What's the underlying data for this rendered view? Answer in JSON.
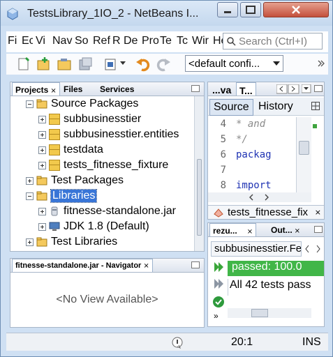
{
  "window": {
    "title": "TestsLibrary_1IO_2 - NetBeans I...",
    "minimize_label": "—",
    "maximize_label": "□",
    "close_label": "✕"
  },
  "menubar": {
    "items": [
      "Fi",
      "Ec",
      "Vi",
      "Nav",
      "So",
      "Ref",
      "R",
      "De",
      "Pro",
      "Te",
      "Tc",
      "Wir",
      "He"
    ],
    "search_placeholder": "Search (Ctrl+I)"
  },
  "toolbar": {
    "config_value": "<default confi...",
    "icons": [
      "new-file-icon",
      "new-project-icon",
      "open-project-icon",
      "close-project-icon",
      "build-icon",
      "undo-icon",
      "redo-icon"
    ]
  },
  "projects_panel": {
    "tabs": [
      "Projects",
      "Files",
      "Services"
    ],
    "tree": [
      {
        "label": "Source Packages",
        "expander": "minus",
        "icon": "folder"
      },
      {
        "label": "subbusinesstier",
        "expander": "plus",
        "icon": "package"
      },
      {
        "label": "subbusinesstier.entities",
        "expander": "plus",
        "icon": "package"
      },
      {
        "label": "testdata",
        "expander": "plus",
        "icon": "package"
      },
      {
        "label": "tests_fitnesse_fixture",
        "expander": "plus",
        "icon": "package"
      },
      {
        "label": "Test Packages",
        "expander": "plus",
        "icon": "folder"
      },
      {
        "label": "Libraries",
        "expander": "minus",
        "icon": "folder",
        "selected": true
      },
      {
        "label": "fitnesse-standalone.jar",
        "expander": "plus",
        "icon": "jar"
      },
      {
        "label": "JDK 1.8 (Default)",
        "expander": "plus",
        "icon": "jdk"
      },
      {
        "label": "Test Libraries",
        "expander": "plus",
        "icon": "folder"
      }
    ]
  },
  "navigator_panel": {
    "tab": "fitnesse-standalone.jar - Navigator",
    "empty_text": "<No View Available>"
  },
  "editor": {
    "tabs": [
      "...va",
      "T..."
    ],
    "source_tab": "Source",
    "history_tab": "History",
    "lines": [
      {
        "num": "4",
        "code": " * and"
      },
      {
        "num": "5",
        "code": " */"
      },
      {
        "num": "6",
        "code": "packag"
      },
      {
        "num": "7",
        "code": ""
      },
      {
        "num": "8",
        "code": "import"
      }
    ],
    "file_tab": "tests_fitnesse_fix"
  },
  "results_panel": {
    "tabs": [
      "rezu...",
      "Out..."
    ],
    "suite_label": "subbusinesstier.Fe",
    "passed_text": "passed: 100.0",
    "summary_text": "All 42 tests pass"
  },
  "statusbar": {
    "position": "20:1",
    "mode": "INS"
  }
}
